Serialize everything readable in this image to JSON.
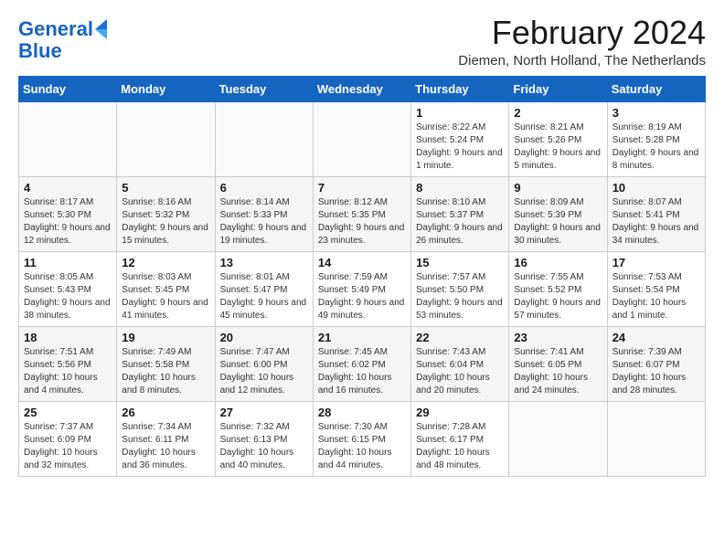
{
  "logo": {
    "line1": "General",
    "line2": "Blue"
  },
  "title": "February 2024",
  "subtitle": "Diemen, North Holland, The Netherlands",
  "days_of_week": [
    "Sunday",
    "Monday",
    "Tuesday",
    "Wednesday",
    "Thursday",
    "Friday",
    "Saturday"
  ],
  "weeks": [
    [
      {
        "num": "",
        "info": ""
      },
      {
        "num": "",
        "info": ""
      },
      {
        "num": "",
        "info": ""
      },
      {
        "num": "",
        "info": ""
      },
      {
        "num": "1",
        "info": "Sunrise: 8:22 AM\nSunset: 5:24 PM\nDaylight: 9 hours and 1 minute."
      },
      {
        "num": "2",
        "info": "Sunrise: 8:21 AM\nSunset: 5:26 PM\nDaylight: 9 hours and 5 minutes."
      },
      {
        "num": "3",
        "info": "Sunrise: 8:19 AM\nSunset: 5:28 PM\nDaylight: 9 hours and 8 minutes."
      }
    ],
    [
      {
        "num": "4",
        "info": "Sunrise: 8:17 AM\nSunset: 5:30 PM\nDaylight: 9 hours and 12 minutes."
      },
      {
        "num": "5",
        "info": "Sunrise: 8:16 AM\nSunset: 5:32 PM\nDaylight: 9 hours and 15 minutes."
      },
      {
        "num": "6",
        "info": "Sunrise: 8:14 AM\nSunset: 5:33 PM\nDaylight: 9 hours and 19 minutes."
      },
      {
        "num": "7",
        "info": "Sunrise: 8:12 AM\nSunset: 5:35 PM\nDaylight: 9 hours and 23 minutes."
      },
      {
        "num": "8",
        "info": "Sunrise: 8:10 AM\nSunset: 5:37 PM\nDaylight: 9 hours and 26 minutes."
      },
      {
        "num": "9",
        "info": "Sunrise: 8:09 AM\nSunset: 5:39 PM\nDaylight: 9 hours and 30 minutes."
      },
      {
        "num": "10",
        "info": "Sunrise: 8:07 AM\nSunset: 5:41 PM\nDaylight: 9 hours and 34 minutes."
      }
    ],
    [
      {
        "num": "11",
        "info": "Sunrise: 8:05 AM\nSunset: 5:43 PM\nDaylight: 9 hours and 38 minutes."
      },
      {
        "num": "12",
        "info": "Sunrise: 8:03 AM\nSunset: 5:45 PM\nDaylight: 9 hours and 41 minutes."
      },
      {
        "num": "13",
        "info": "Sunrise: 8:01 AM\nSunset: 5:47 PM\nDaylight: 9 hours and 45 minutes."
      },
      {
        "num": "14",
        "info": "Sunrise: 7:59 AM\nSunset: 5:49 PM\nDaylight: 9 hours and 49 minutes."
      },
      {
        "num": "15",
        "info": "Sunrise: 7:57 AM\nSunset: 5:50 PM\nDaylight: 9 hours and 53 minutes."
      },
      {
        "num": "16",
        "info": "Sunrise: 7:55 AM\nSunset: 5:52 PM\nDaylight: 9 hours and 57 minutes."
      },
      {
        "num": "17",
        "info": "Sunrise: 7:53 AM\nSunset: 5:54 PM\nDaylight: 10 hours and 1 minute."
      }
    ],
    [
      {
        "num": "18",
        "info": "Sunrise: 7:51 AM\nSunset: 5:56 PM\nDaylight: 10 hours and 4 minutes."
      },
      {
        "num": "19",
        "info": "Sunrise: 7:49 AM\nSunset: 5:58 PM\nDaylight: 10 hours and 8 minutes."
      },
      {
        "num": "20",
        "info": "Sunrise: 7:47 AM\nSunset: 6:00 PM\nDaylight: 10 hours and 12 minutes."
      },
      {
        "num": "21",
        "info": "Sunrise: 7:45 AM\nSunset: 6:02 PM\nDaylight: 10 hours and 16 minutes."
      },
      {
        "num": "22",
        "info": "Sunrise: 7:43 AM\nSunset: 6:04 PM\nDaylight: 10 hours and 20 minutes."
      },
      {
        "num": "23",
        "info": "Sunrise: 7:41 AM\nSunset: 6:05 PM\nDaylight: 10 hours and 24 minutes."
      },
      {
        "num": "24",
        "info": "Sunrise: 7:39 AM\nSunset: 6:07 PM\nDaylight: 10 hours and 28 minutes."
      }
    ],
    [
      {
        "num": "25",
        "info": "Sunrise: 7:37 AM\nSunset: 6:09 PM\nDaylight: 10 hours and 32 minutes."
      },
      {
        "num": "26",
        "info": "Sunrise: 7:34 AM\nSunset: 6:11 PM\nDaylight: 10 hours and 36 minutes."
      },
      {
        "num": "27",
        "info": "Sunrise: 7:32 AM\nSunset: 6:13 PM\nDaylight: 10 hours and 40 minutes."
      },
      {
        "num": "28",
        "info": "Sunrise: 7:30 AM\nSunset: 6:15 PM\nDaylight: 10 hours and 44 minutes."
      },
      {
        "num": "29",
        "info": "Sunrise: 7:28 AM\nSunset: 6:17 PM\nDaylight: 10 hours and 48 minutes."
      },
      {
        "num": "",
        "info": ""
      },
      {
        "num": "",
        "info": ""
      }
    ]
  ]
}
